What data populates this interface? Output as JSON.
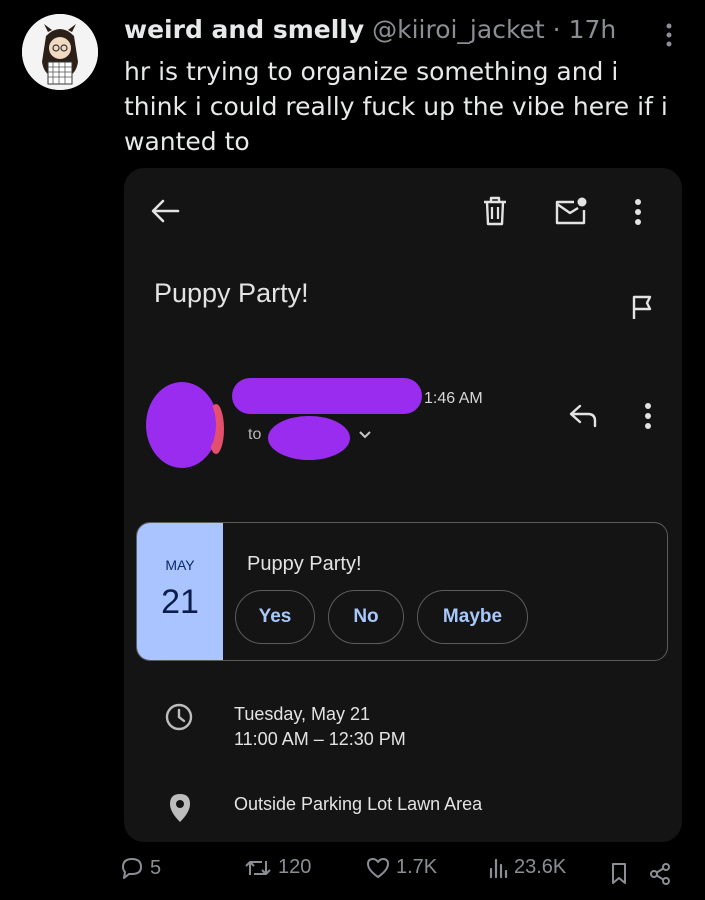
{
  "tweet": {
    "author_name": "weird and smelly",
    "handle": "@kiiroi_jacket",
    "separator": "·",
    "time": "17h",
    "text": "hr is trying to organize something and i think i could really fuck up the vibe here if i wanted to"
  },
  "email": {
    "subject": "Puppy Party!",
    "sender_time": "1:46 AM",
    "to_label": "to",
    "toolbar_icons": [
      "back-arrow-icon",
      "trash-icon",
      "mark-unread-icon",
      "more-vert-icon"
    ],
    "invite": {
      "month": "MAY",
      "day": "21",
      "title": "Puppy Party!",
      "rsvp_yes": "Yes",
      "rsvp_no": "No",
      "rsvp_maybe": "Maybe"
    },
    "event_date": "Tuesday, May 21",
    "event_time": "11:00 AM – 12:30 PM",
    "event_location": "Outside Parking Lot Lawn Area"
  },
  "actions": {
    "replies": "5",
    "reposts": "120",
    "likes": "1.7K",
    "views": "23.6K"
  },
  "colors": {
    "background": "#000000",
    "card": "#141414",
    "redaction": "#9a2cf0",
    "date_block": "#aac4ff",
    "rsvp_text": "#a8c7fa"
  }
}
